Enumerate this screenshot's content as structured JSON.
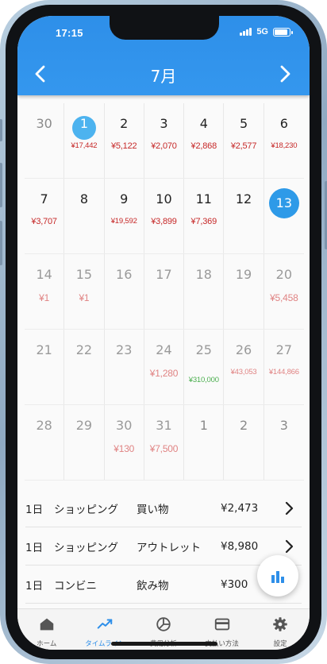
{
  "status": {
    "time": "17:15",
    "network": "5G",
    "battery_level": 0.9
  },
  "header": {
    "month": "7月"
  },
  "calendar": {
    "weeks": [
      [
        {
          "day": "30",
          "amount": "",
          "state": "other"
        },
        {
          "day": "1",
          "amount": "¥17,442",
          "state": "highlight",
          "small": true
        },
        {
          "day": "2",
          "amount": "¥5,122",
          "state": "past"
        },
        {
          "day": "3",
          "amount": "¥2,070",
          "state": "past"
        },
        {
          "day": "4",
          "amount": "¥2,868",
          "state": "past"
        },
        {
          "day": "5",
          "amount": "¥2,577",
          "state": "past"
        },
        {
          "day": "6",
          "amount": "¥18,230",
          "state": "past",
          "small": true
        }
      ],
      [
        {
          "day": "7",
          "amount": "¥3,707",
          "state": "past"
        },
        {
          "day": "8",
          "amount": "",
          "state": "past"
        },
        {
          "day": "9",
          "amount": "¥19,592",
          "state": "past",
          "small": true
        },
        {
          "day": "10",
          "amount": "¥3,899",
          "state": "past"
        },
        {
          "day": "11",
          "amount": "¥7,369",
          "state": "past"
        },
        {
          "day": "12",
          "amount": "",
          "state": "past"
        },
        {
          "day": "13",
          "amount": "",
          "state": "today"
        }
      ],
      [
        {
          "day": "14",
          "amount": "¥1",
          "state": "future"
        },
        {
          "day": "15",
          "amount": "¥1",
          "state": "future"
        },
        {
          "day": "16",
          "amount": "",
          "state": "future"
        },
        {
          "day": "17",
          "amount": "",
          "state": "future"
        },
        {
          "day": "18",
          "amount": "",
          "state": "future"
        },
        {
          "day": "19",
          "amount": "",
          "state": "future"
        },
        {
          "day": "20",
          "amount": "¥5,458",
          "state": "future"
        }
      ],
      [
        {
          "day": "21",
          "amount": "",
          "state": "future"
        },
        {
          "day": "22",
          "amount": "",
          "state": "future"
        },
        {
          "day": "23",
          "amount": "",
          "state": "future"
        },
        {
          "day": "24",
          "amount": "¥1,280",
          "state": "future"
        },
        {
          "day": "25",
          "amount": "¥310,000",
          "state": "future",
          "income": true
        },
        {
          "day": "26",
          "amount": "¥43,053",
          "state": "future",
          "small": true
        },
        {
          "day": "27",
          "amount": "¥144,866",
          "state": "future",
          "small": true
        }
      ],
      [
        {
          "day": "28",
          "amount": "",
          "state": "future"
        },
        {
          "day": "29",
          "amount": "",
          "state": "future"
        },
        {
          "day": "30",
          "amount": "¥130",
          "state": "future"
        },
        {
          "day": "31",
          "amount": "¥7,500",
          "state": "future"
        },
        {
          "day": "1",
          "amount": "",
          "state": "other"
        },
        {
          "day": "2",
          "amount": "",
          "state": "other"
        },
        {
          "day": "3",
          "amount": "",
          "state": "other"
        }
      ]
    ]
  },
  "transactions": [
    {
      "day": "1日",
      "category": "ショッピング",
      "subcategory": "買い物",
      "amount": "¥2,473"
    },
    {
      "day": "1日",
      "category": "ショッピング",
      "subcategory": "アウトレット",
      "amount": "¥8,980"
    },
    {
      "day": "1日",
      "category": "コンビニ",
      "subcategory": "飲み物",
      "amount": "¥300"
    }
  ],
  "bottom_nav": [
    {
      "label": "ホーム",
      "icon": "home-icon"
    },
    {
      "label": "タイムライン",
      "icon": "timeline-icon",
      "active": true
    },
    {
      "label": "費用分析",
      "icon": "pie-chart-icon"
    },
    {
      "label": "支払い方法",
      "icon": "credit-card-icon"
    },
    {
      "label": "設定",
      "icon": "gear-icon"
    }
  ],
  "colors": {
    "primary": "#2e8fe9",
    "expense": "#c62828",
    "expense_future": "#e08484",
    "income": "#4caf50",
    "today": "#2e9ae8",
    "selected": "#4db3ef"
  }
}
